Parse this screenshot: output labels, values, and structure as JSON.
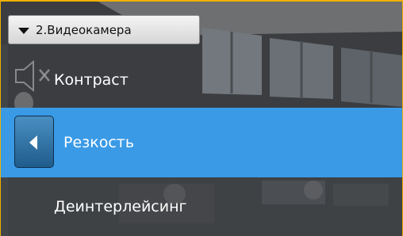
{
  "camera_selector": {
    "label": "2.Видеокамера"
  },
  "menu": {
    "items": [
      {
        "label": "Контраст",
        "selected": false
      },
      {
        "label": "Резкость",
        "selected": true
      },
      {
        "label": "Деинтерлейсинг",
        "selected": false
      }
    ]
  },
  "colors": {
    "selection": "#3a9ae6",
    "back_button": "#2b6ea3",
    "frame_border": "#f0b000",
    "menu_text": "#ffffff"
  },
  "icons": {
    "dropdown": "dropdown-triangle-icon",
    "mute": "speaker-muted-icon",
    "back": "back-arrow-icon"
  }
}
